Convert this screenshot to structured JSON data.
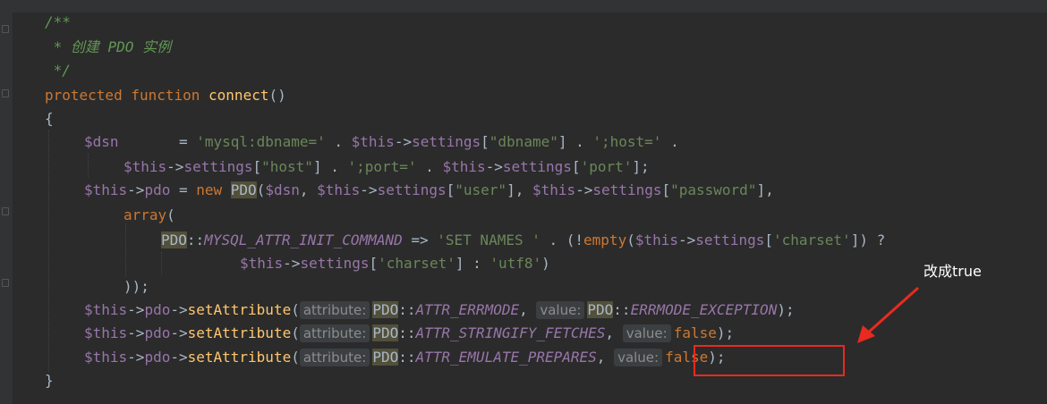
{
  "code": {
    "l1": "/**",
    "l2": " * 创建 PDO 实例",
    "l3": " */",
    "l4_kw": "protected function",
    "l4_fn": "connect",
    "l4_tail": "()",
    "l5": "{",
    "l6_var": "$dsn",
    "l6_eq": "       = ",
    "l6_s1": "'mysql:dbname='",
    "l6_dot1": " . ",
    "l6_this": "$this",
    "l6_arrow": "->",
    "l6_prop": "settings",
    "l6_b1": "[",
    "l6_s2": "\"dbname\"",
    "l6_b2": "] . ",
    "l6_s3": "';host='",
    "l6_end": " .",
    "l7_this": "$this",
    "l7_arrow": "->",
    "l7_prop": "settings",
    "l7_b1": "[",
    "l7_s1": "\"host\"",
    "l7_b2": "] . ",
    "l7_s2": "';port='",
    "l7_dot": " . ",
    "l7_this2": "$this",
    "l7_arrow2": "->",
    "l7_prop2": "settings",
    "l7_b3": "[",
    "l7_s3": "'port'",
    "l7_end": "];",
    "l8_this": "$this",
    "l8_arrow": "->",
    "l8_prop": "pdo",
    "l8_eq": " = ",
    "l8_new": "new ",
    "l8_cls": "PDO",
    "l8_p1": "(",
    "l8_dsn": "$dsn",
    "l8_c1": ", ",
    "l8_this2": "$this",
    "l8_arrow2": "->",
    "l8_prop2": "settings",
    "l8_b1": "[",
    "l8_s1": "\"user\"",
    "l8_b2": "], ",
    "l8_this3": "$this",
    "l8_arrow3": "->",
    "l8_prop3": "settings",
    "l8_b3": "[",
    "l8_s2": "\"password\"",
    "l8_end": "],",
    "l9_kw": "array",
    "l9_p": "(",
    "l10_cls": "PDO",
    "l10_sep": "::",
    "l10_const": "MYSQL_ATTR_INIT_COMMAND",
    "l10_op": " => ",
    "l10_s1": "'SET NAMES '",
    "l10_dot": " . (!",
    "l10_fn": "empty",
    "l10_p": "(",
    "l10_this": "$this",
    "l10_arrow": "->",
    "l10_prop": "settings",
    "l10_b1": "[",
    "l10_s2": "'charset'",
    "l10_end": "]) ?",
    "l11_this": "$this",
    "l11_arrow": "->",
    "l11_prop": "settings",
    "l11_b1": "[",
    "l11_s1": "'charset'",
    "l11_mid": "] : ",
    "l11_s2": "'utf8'",
    "l11_end": ")",
    "l12": "));",
    "setattr": {
      "this": "$this",
      "arrow": "->",
      "prop": "pdo",
      "arrow2": "->",
      "fn": "setAttribute",
      "paren": "(",
      "hint_attr": "attribute:",
      "hint_value": "value:",
      "cls": "PDO",
      "sep": "::"
    },
    "l13_const": "ATTR_ERRMODE",
    "l13_comma": ", ",
    "l13_cls": "PDO",
    "l13_sep": "::",
    "l13_const2": "ERRMODE_EXCEPTION",
    "l13_end": ");",
    "l14_const": "ATTR_STRINGIFY_FETCHES",
    "l14_comma": ", ",
    "l14_val": "false",
    "l14_end": ");",
    "l15_const": "ATTR_EMULATE_PREPARES",
    "l15_comma": ", ",
    "l15_val": "false",
    "l15_end": ");",
    "l16": "}"
  },
  "annotation": {
    "text": "改成true",
    "color": "#e82a20"
  }
}
